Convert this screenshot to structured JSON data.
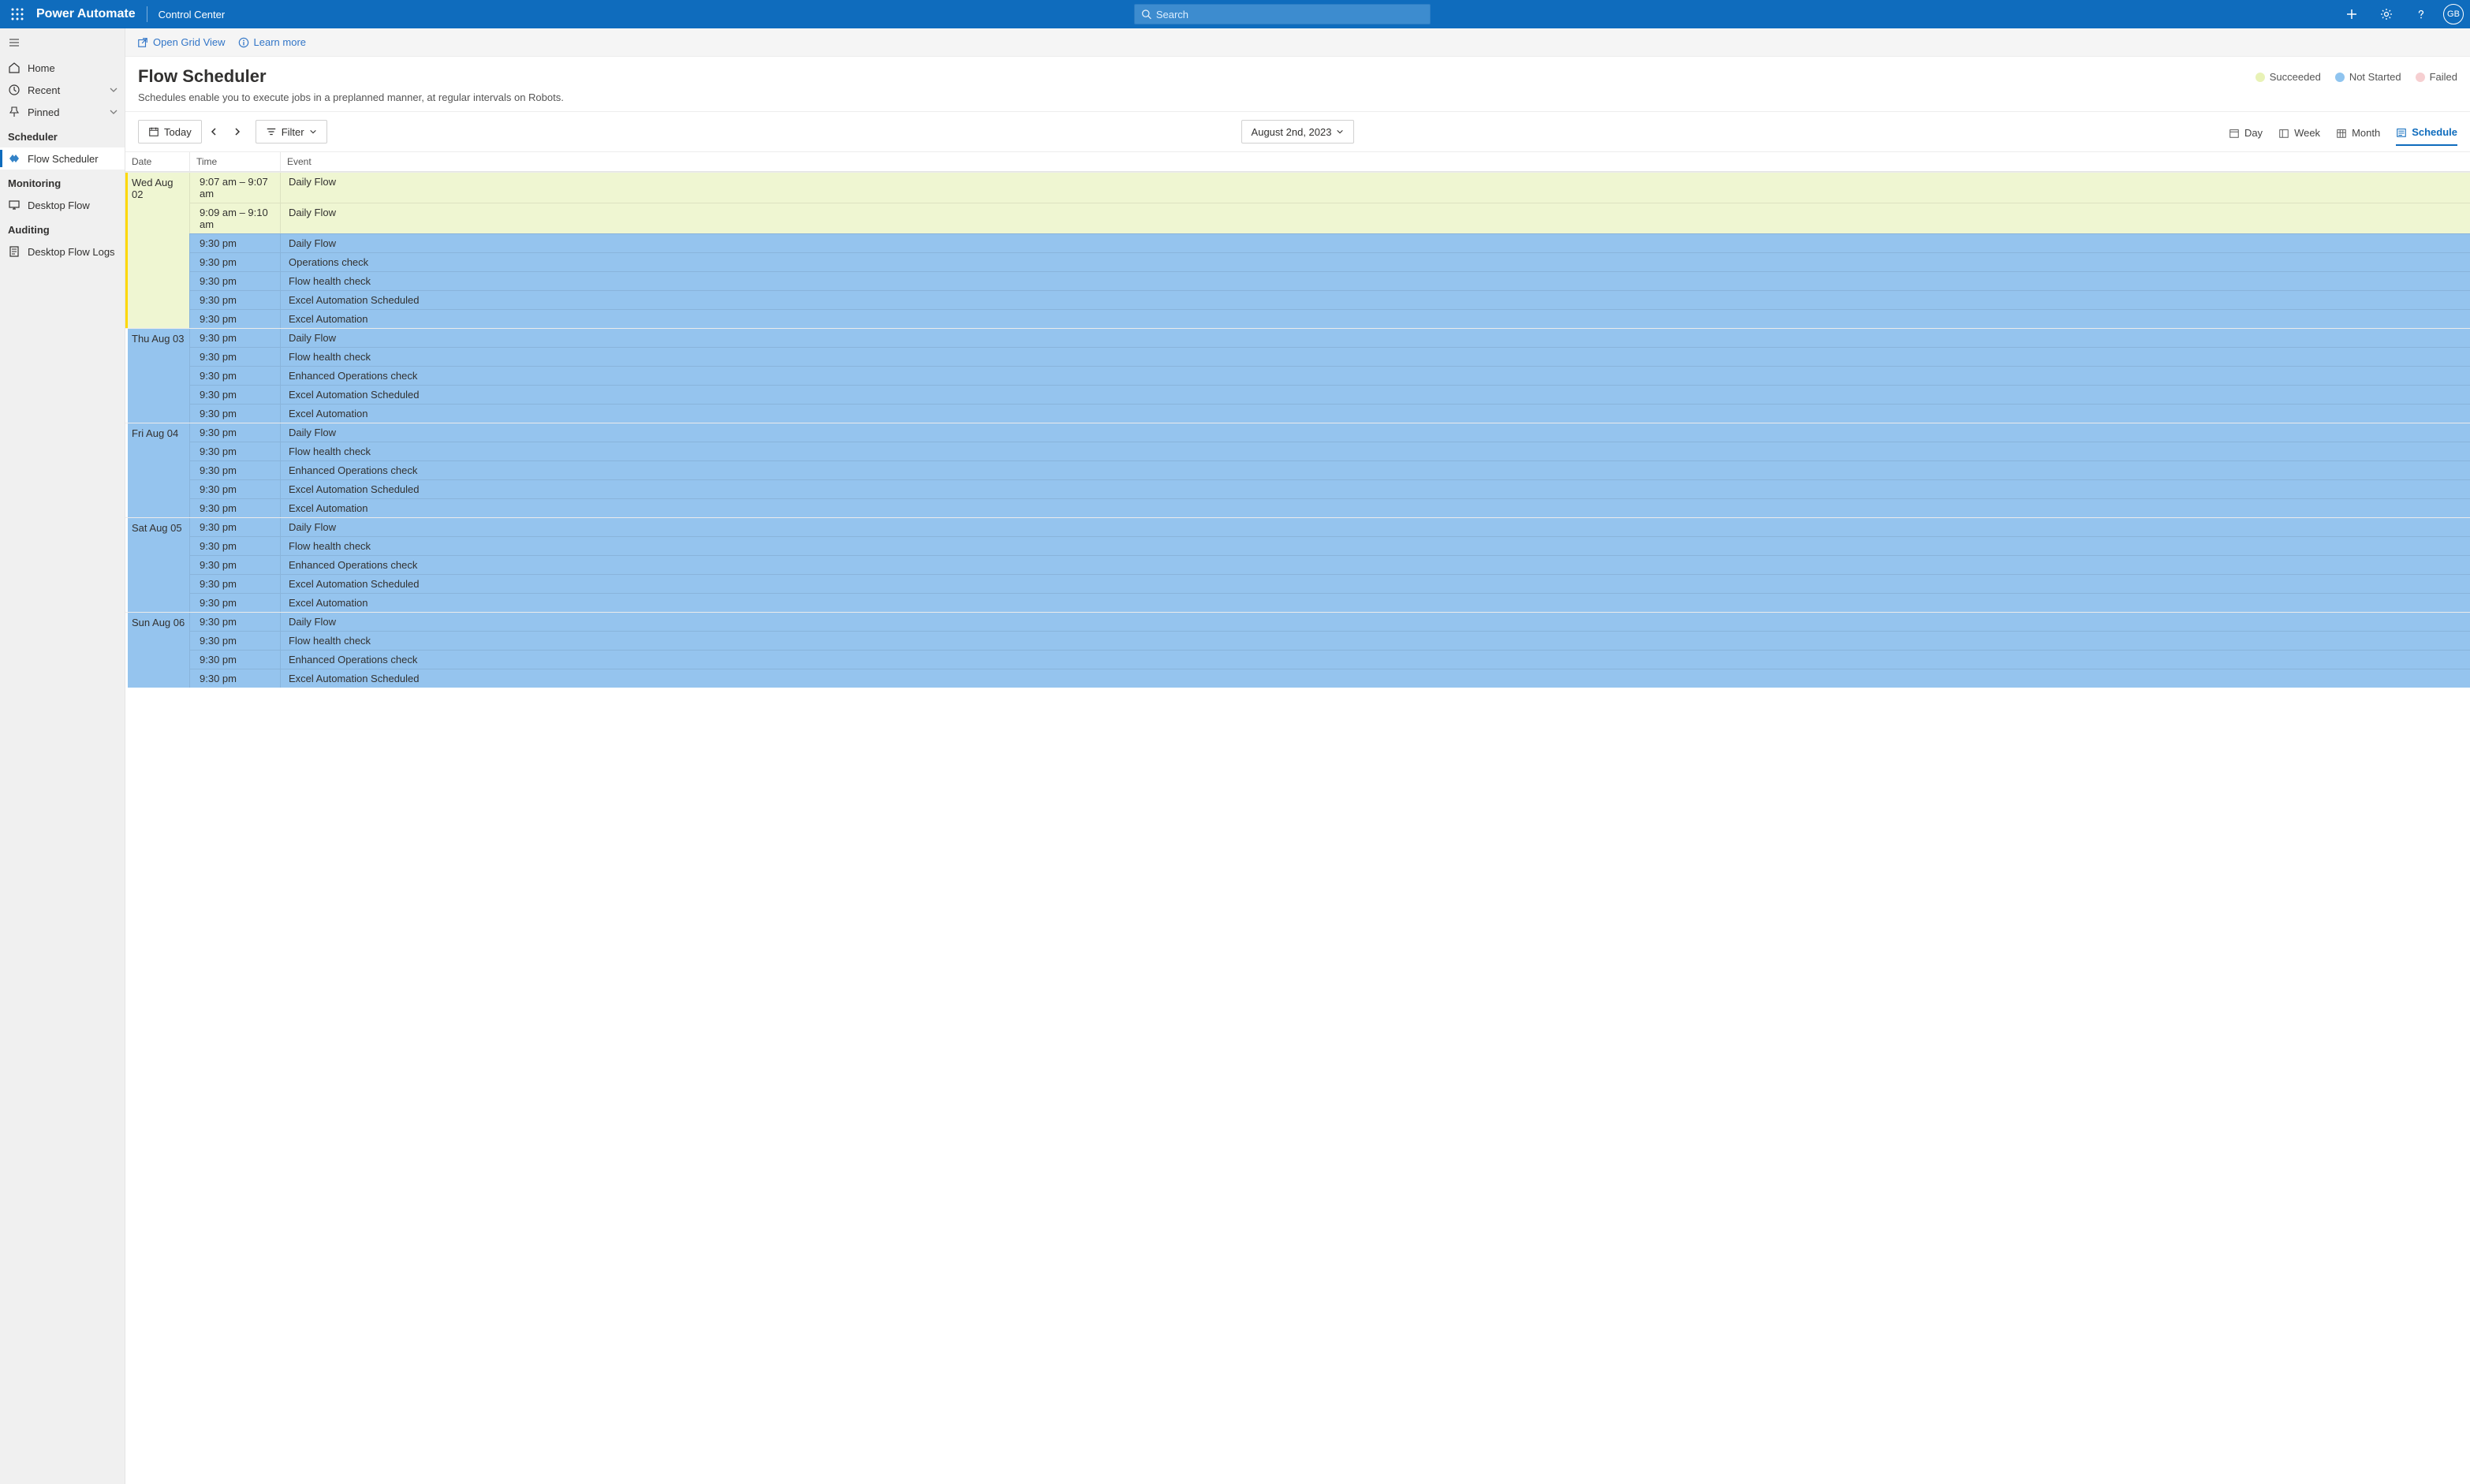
{
  "topbar": {
    "brand": "Power Automate",
    "location": "Control Center",
    "search_placeholder": "Search",
    "avatar": "GB"
  },
  "sidebar": {
    "home": "Home",
    "recent": "Recent",
    "pinned": "Pinned",
    "scheduler_head": "Scheduler",
    "flow_scheduler": "Flow Scheduler",
    "monitoring_head": "Monitoring",
    "desktop_flow": "Desktop Flow",
    "auditing_head": "Auditing",
    "desktop_flow_logs": "Desktop Flow Logs"
  },
  "cmdbar": {
    "open_grid": "Open Grid View",
    "learn_more": "Learn more"
  },
  "page": {
    "title": "Flow Scheduler",
    "subtitle": "Schedules enable you to execute jobs in a preplanned manner, at regular intervals on Robots."
  },
  "legend": {
    "succeeded": {
      "label": "Succeeded",
      "color": "#e8f2b6"
    },
    "notstarted": {
      "label": "Not Started",
      "color": "#8fc4ef"
    },
    "failed": {
      "label": "Failed",
      "color": "#f6cfd1"
    }
  },
  "toolbar": {
    "today": "Today",
    "filter": "Filter",
    "date": "August 2nd, 2023",
    "views": {
      "day": "Day",
      "week": "Week",
      "month": "Month",
      "schedule": "Schedule"
    }
  },
  "table": {
    "col_date": "Date",
    "col_time": "Time",
    "col_event": "Event"
  },
  "schedule": [
    {
      "date": "Wed Aug 02",
      "today": true,
      "rows": [
        {
          "time": "9:07 am – 9:07 am",
          "event": "Daily Flow",
          "status": "succeeded"
        },
        {
          "time": "9:09 am – 9:10 am",
          "event": "Daily Flow",
          "status": "succeeded"
        },
        {
          "time": "9:30 pm",
          "event": "Daily Flow",
          "status": "notstarted"
        },
        {
          "time": "9:30 pm",
          "event": "Operations check",
          "status": "notstarted"
        },
        {
          "time": "9:30 pm",
          "event": "Flow health check",
          "status": "notstarted"
        },
        {
          "time": "9:30 pm",
          "event": "Excel Automation Scheduled",
          "status": "notstarted"
        },
        {
          "time": "9:30 pm",
          "event": "Excel Automation",
          "status": "notstarted"
        }
      ]
    },
    {
      "date": "Thu Aug 03",
      "rows": [
        {
          "time": "9:30 pm",
          "event": "Daily Flow",
          "status": "notstarted"
        },
        {
          "time": "9:30 pm",
          "event": "Flow health check",
          "status": "notstarted"
        },
        {
          "time": "9:30 pm",
          "event": "Enhanced Operations check",
          "status": "notstarted"
        },
        {
          "time": "9:30 pm",
          "event": "Excel Automation Scheduled",
          "status": "notstarted"
        },
        {
          "time": "9:30 pm",
          "event": "Excel Automation",
          "status": "notstarted"
        }
      ]
    },
    {
      "date": "Fri Aug 04",
      "rows": [
        {
          "time": "9:30 pm",
          "event": "Daily Flow",
          "status": "notstarted"
        },
        {
          "time": "9:30 pm",
          "event": "Flow health check",
          "status": "notstarted"
        },
        {
          "time": "9:30 pm",
          "event": "Enhanced Operations check",
          "status": "notstarted"
        },
        {
          "time": "9:30 pm",
          "event": "Excel Automation Scheduled",
          "status": "notstarted"
        },
        {
          "time": "9:30 pm",
          "event": "Excel Automation",
          "status": "notstarted"
        }
      ]
    },
    {
      "date": "Sat Aug 05",
      "rows": [
        {
          "time": "9:30 pm",
          "event": "Daily Flow",
          "status": "notstarted"
        },
        {
          "time": "9:30 pm",
          "event": "Flow health check",
          "status": "notstarted"
        },
        {
          "time": "9:30 pm",
          "event": "Enhanced Operations check",
          "status": "notstarted"
        },
        {
          "time": "9:30 pm",
          "event": "Excel Automation Scheduled",
          "status": "notstarted"
        },
        {
          "time": "9:30 pm",
          "event": "Excel Automation",
          "status": "notstarted"
        }
      ]
    },
    {
      "date": "Sun Aug 06",
      "rows": [
        {
          "time": "9:30 pm",
          "event": "Daily Flow",
          "status": "notstarted"
        },
        {
          "time": "9:30 pm",
          "event": "Flow health check",
          "status": "notstarted"
        },
        {
          "time": "9:30 pm",
          "event": "Enhanced Operations check",
          "status": "notstarted"
        },
        {
          "time": "9:30 pm",
          "event": "Excel Automation Scheduled",
          "status": "notstarted"
        }
      ]
    }
  ]
}
